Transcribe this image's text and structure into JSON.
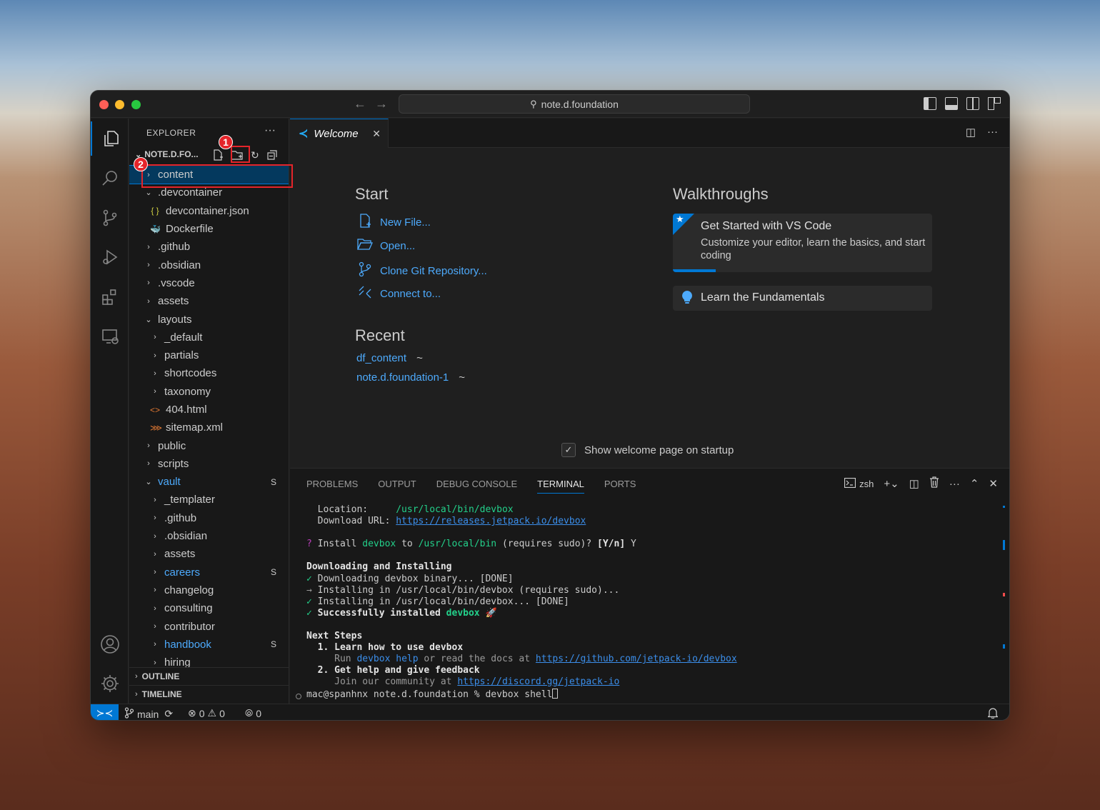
{
  "titlebar": {
    "search_text": "note.d.foundation"
  },
  "explorer": {
    "title": "EXPLORER",
    "root_name": "NOTE.D.FO...",
    "more": "···",
    "items": [
      {
        "label": "content",
        "type": "folder",
        "depth": 1,
        "open": false,
        "selected": true
      },
      {
        "label": ".devcontainer",
        "type": "folder",
        "depth": 1,
        "open": true
      },
      {
        "label": "devcontainer.json",
        "type": "json",
        "depth": 2
      },
      {
        "label": "Dockerfile",
        "type": "docker",
        "depth": 2
      },
      {
        "label": ".github",
        "type": "folder",
        "depth": 1
      },
      {
        "label": ".obsidian",
        "type": "folder",
        "depth": 1
      },
      {
        "label": ".vscode",
        "type": "folder",
        "depth": 1
      },
      {
        "label": "assets",
        "type": "folder",
        "depth": 1
      },
      {
        "label": "layouts",
        "type": "folder",
        "depth": 1,
        "open": true
      },
      {
        "label": "_default",
        "type": "folder",
        "depth": 2
      },
      {
        "label": "partials",
        "type": "folder",
        "depth": 2
      },
      {
        "label": "shortcodes",
        "type": "folder",
        "depth": 2
      },
      {
        "label": "taxonomy",
        "type": "folder",
        "depth": 2
      },
      {
        "label": "404.html",
        "type": "html",
        "depth": 2
      },
      {
        "label": "sitemap.xml",
        "type": "xml",
        "depth": 2
      },
      {
        "label": "public",
        "type": "folder",
        "depth": 1
      },
      {
        "label": "scripts",
        "type": "folder",
        "depth": 1
      },
      {
        "label": "vault",
        "type": "folder",
        "depth": 1,
        "open": true,
        "blue": true,
        "badge": "S"
      },
      {
        "label": "_templater",
        "type": "folder",
        "depth": 2
      },
      {
        "label": ".github",
        "type": "folder",
        "depth": 2
      },
      {
        "label": ".obsidian",
        "type": "folder",
        "depth": 2
      },
      {
        "label": "assets",
        "type": "folder",
        "depth": 2
      },
      {
        "label": "careers",
        "type": "folder",
        "depth": 2,
        "blue": true,
        "badge": "S"
      },
      {
        "label": "changelog",
        "type": "folder",
        "depth": 2
      },
      {
        "label": "consulting",
        "type": "folder",
        "depth": 2
      },
      {
        "label": "contributor",
        "type": "folder",
        "depth": 2
      },
      {
        "label": "handbook",
        "type": "folder",
        "depth": 2,
        "blue": true,
        "badge": "S"
      },
      {
        "label": "hiring",
        "type": "folder",
        "depth": 2
      }
    ],
    "outline": "OUTLINE",
    "timeline": "TIMELINE"
  },
  "tab": {
    "label": "Welcome"
  },
  "welcome": {
    "start_heading": "Start",
    "start_items": [
      {
        "label": "New File...",
        "icon": "new-file-icon"
      },
      {
        "label": "Open...",
        "icon": "folder-open-icon"
      },
      {
        "label": "Clone Git Repository...",
        "icon": "source-control-icon"
      },
      {
        "label": "Connect to...",
        "icon": "remote-icon"
      }
    ],
    "recent_heading": "Recent",
    "recent_items": [
      {
        "name": "df_content",
        "path": "~"
      },
      {
        "name": "note.d.foundation-1",
        "path": "~"
      }
    ],
    "walkthroughs_heading": "Walkthroughs",
    "walk1_title": "Get Started with VS Code",
    "walk1_desc": "Customize your editor, learn the basics, and start coding",
    "walk2_title": "Learn the Fundamentals",
    "startup_label": "Show welcome page on startup"
  },
  "panel": {
    "tabs": [
      "PROBLEMS",
      "OUTPUT",
      "DEBUG CONSOLE",
      "TERMINAL",
      "PORTS"
    ],
    "active_tab": "TERMINAL",
    "shell": "zsh"
  },
  "terminal": {
    "location_label": "  Location:     ",
    "location_value": "/usr/local/bin/devbox",
    "download_label": "  Download URL: ",
    "download_value": "https://releases.jetpack.io/devbox",
    "q_mark": "?",
    "install_1": " Install ",
    "install_devbox": "devbox",
    "install_2": " to ",
    "install_path": "/usr/local/bin",
    "install_3": " (requires sudo)? ",
    "install_yn": "[Y/n]",
    "install_ans": " Y",
    "dl_heading": "Downloading and Installing",
    "check1": "✓",
    "line1": " Downloading devbox binary... [DONE]",
    "arrow": "→",
    "line2": " Installing in /usr/local/bin/devbox (requires sudo)...",
    "check2": "✓",
    "line3": " Installing in /usr/local/bin/devbox... [DONE]",
    "check3": "✓",
    "line4": " Successfully installed ",
    "line4_devbox": "devbox",
    "rocket": " 🚀",
    "next_heading": "Next Steps",
    "step1": "  1. Learn how to use devbox",
    "step1_run": "     Run ",
    "step1_cmd": "devbox help",
    "step1_mid": " or read the docs at ",
    "step1_url": "https://github.com/jetpack-io/devbox",
    "step2": "  2. Get help and give feedback",
    "step2_join": "     Join our community at ",
    "step2_url": "https://discord.gg/jetpack-io",
    "prompt": "mac@spanhnx note.d.foundation % devbox shell"
  },
  "status": {
    "branch": "main",
    "errors": "0",
    "warnings": "0",
    "ports": "0"
  },
  "annotations": {
    "badge1": "1",
    "badge2": "2"
  }
}
